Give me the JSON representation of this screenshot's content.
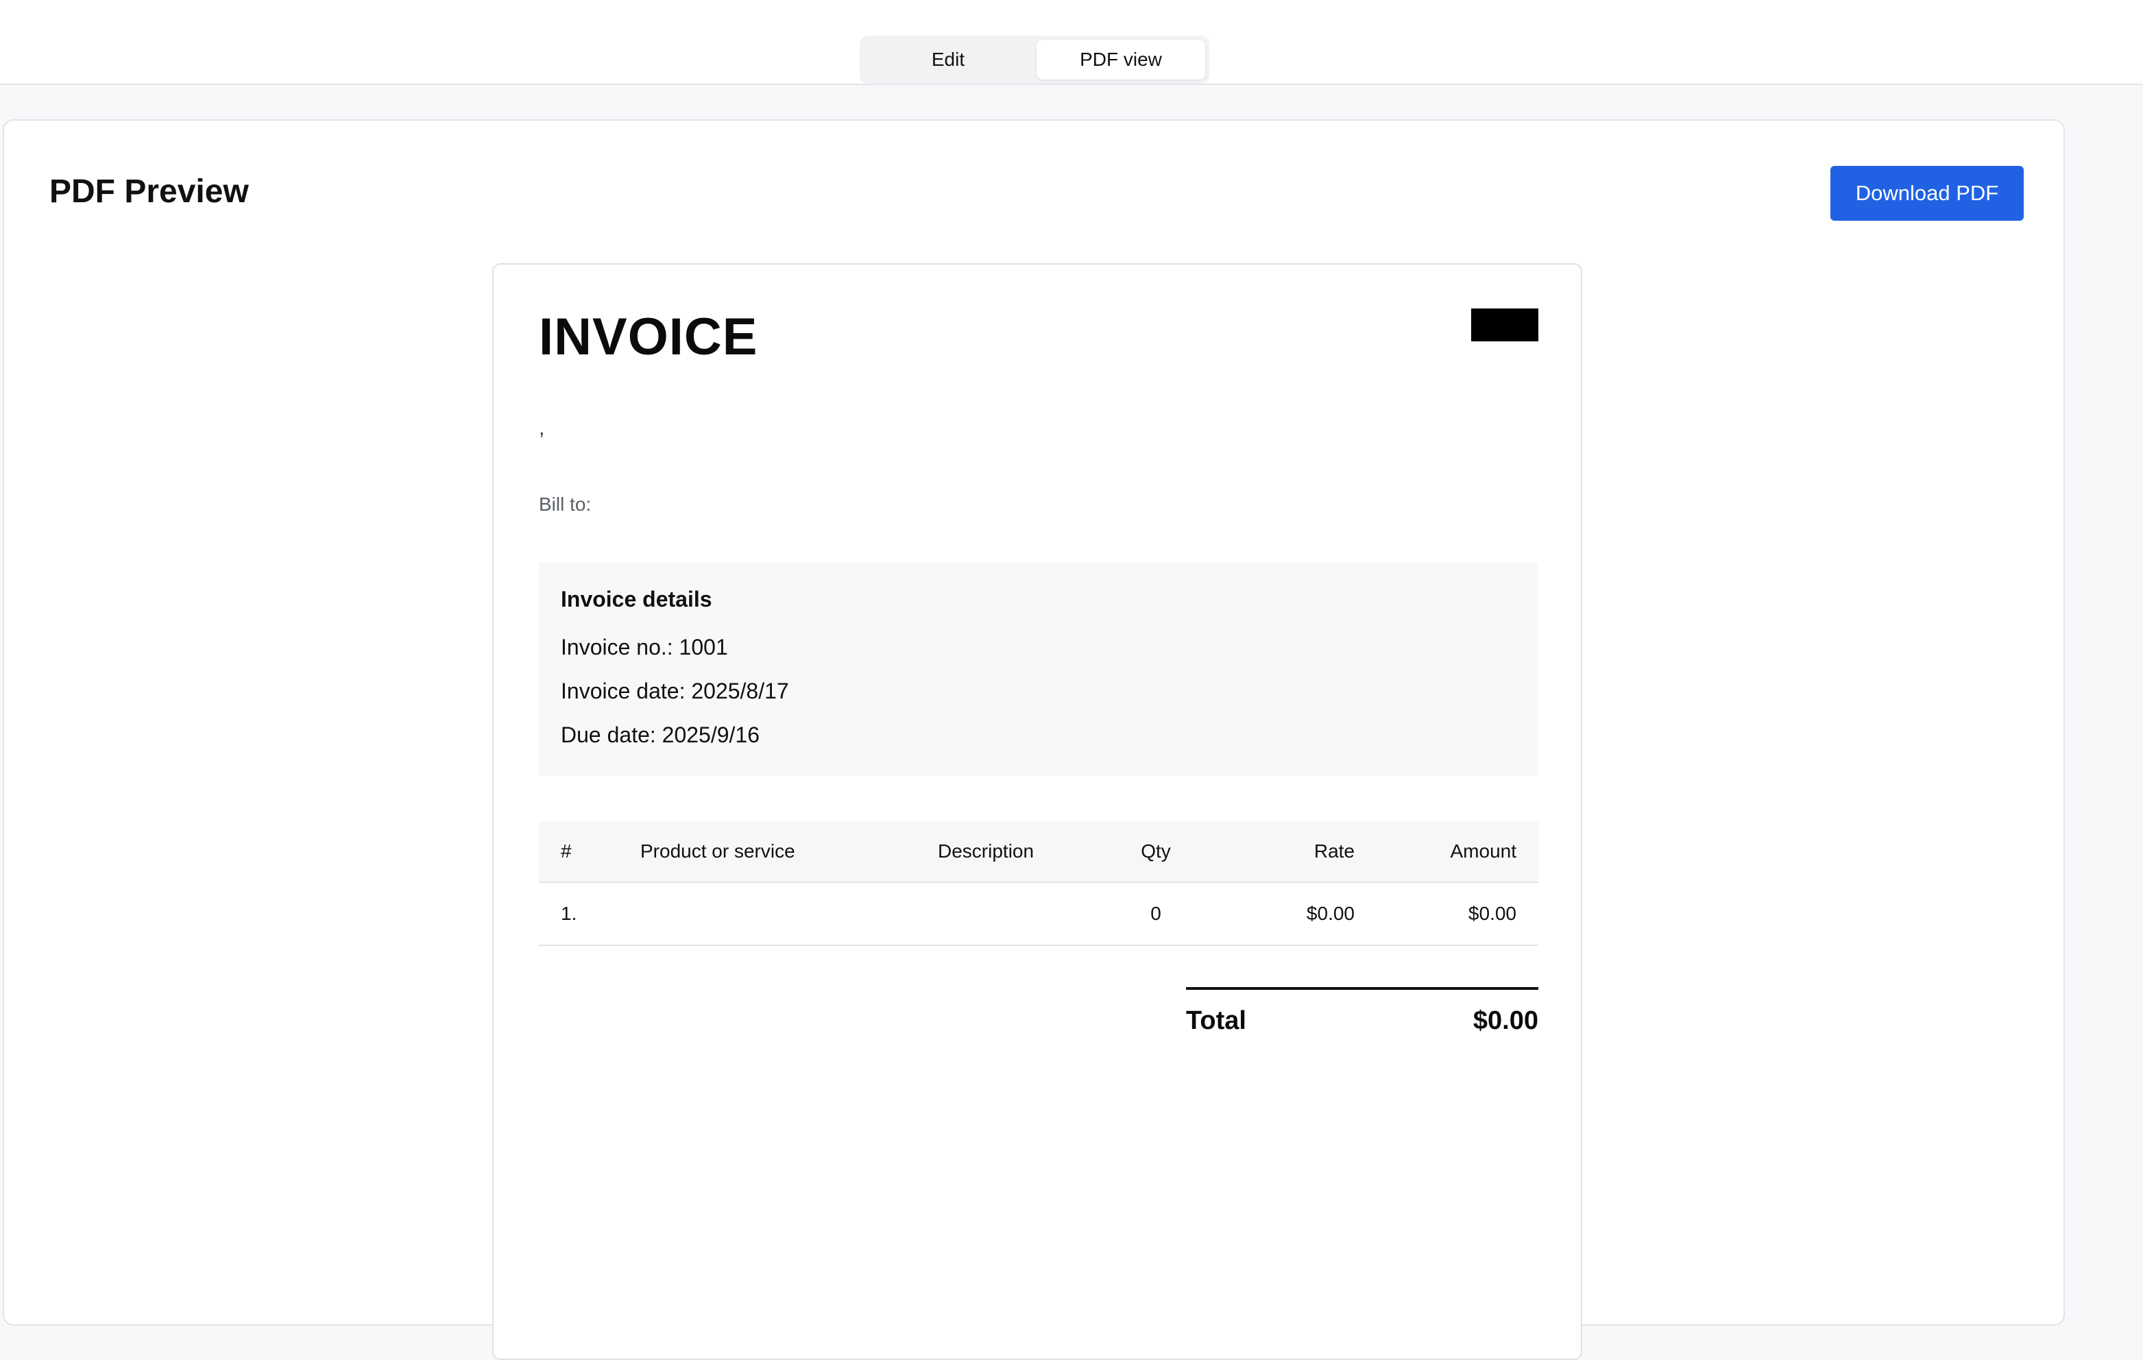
{
  "view_toggle": {
    "options": [
      {
        "label": "Edit",
        "active": false
      },
      {
        "label": "PDF view",
        "active": true
      }
    ]
  },
  "panel": {
    "title": "PDF Preview",
    "download_label": "Download PDF",
    "accent_color": "#2162e4"
  },
  "invoice": {
    "title": "INVOICE",
    "sender_line": ",",
    "bill_to_label": "Bill to:",
    "details": {
      "heading": "Invoice details",
      "invoice_no": "Invoice no.: 1001",
      "invoice_date": "Invoice date: 2025/8/17",
      "due_date": "Due date: 2025/9/16"
    },
    "table": {
      "headers": {
        "num": "#",
        "product": "Product or service",
        "description": "Description",
        "qty": "Qty",
        "rate": "Rate",
        "amount": "Amount"
      },
      "rows": [
        {
          "num": "1.",
          "product": "",
          "description": "",
          "qty": "0",
          "rate": "$0.00",
          "amount": "$0.00"
        }
      ]
    },
    "total_label": "Total",
    "total_value": "$0.00"
  }
}
